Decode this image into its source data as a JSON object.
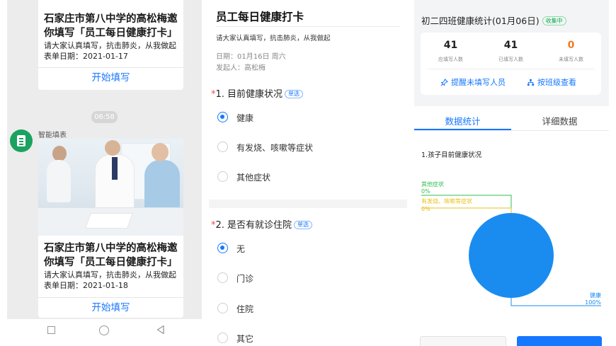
{
  "chat": {
    "card1": {
      "title": "石家庄市第八中学的高松梅邀你填写「员工每日健康打卡」",
      "desc": "请大家认真填写，抗击肺炎，从我做起",
      "date": "表单日期：2021-01-17",
      "button": "开始填写"
    },
    "time": "06:58",
    "sender": "智能填表",
    "card2": {
      "title": "石家庄市第八中学的高松梅邀你填写「员工每日健康打卡」",
      "desc": "请大家认真填写，抗击肺炎，从我做起",
      "date": "表单日期：2021-01-18",
      "button": "开始填写"
    }
  },
  "form": {
    "title": "员工每日健康打卡",
    "subtitle": "请大家认真填写，抗击肺炎，从我做起",
    "date": "日期：01月16日 周六",
    "creator": "发起人：高松梅",
    "q1": {
      "star": "*",
      "label": "1. 目前健康状况",
      "tag": "单选",
      "options": [
        "健康",
        "有发烧、咳嗽等症状",
        "其他症状"
      ],
      "selected": 0
    },
    "q2": {
      "star": "*",
      "label": "2. 是否有就诊住院",
      "tag": "单选",
      "options": [
        "无",
        "门诊",
        "住院",
        "其它"
      ],
      "selected": 0
    }
  },
  "stats": {
    "title": "初二四班健康统计(01月06日)",
    "status_tag": "收集中",
    "metrics": [
      {
        "value": "41",
        "label": "应填写人数"
      },
      {
        "value": "41",
        "label": "已填写人数"
      },
      {
        "value": "0",
        "label": "未填写人数"
      }
    ],
    "actions": {
      "remind": "提醒未填写人员",
      "by_class": "按班级查看"
    },
    "tabs": [
      "数据统计",
      "详细数据"
    ],
    "chart_question": "1.孩子目前健康状况",
    "colors": {
      "accent": "#1677ff",
      "series_blue": "#1a8cf0",
      "series_green": "#2fbf4f",
      "series_yellow": "#e7c21c",
      "warning": "#f07b22"
    }
  },
  "chart_data": {
    "type": "pie",
    "title": "1.孩子目前健康状况",
    "slices": [
      {
        "label": "健康",
        "value": 100,
        "display": "100%",
        "color": "#1a8cf0"
      },
      {
        "label": "其他症状",
        "value": 0,
        "display": "0%",
        "color": "#2fbf4f"
      },
      {
        "label": "有发烧、咳嗽等症状",
        "value": 0,
        "display": "0%",
        "color": "#e7c21c"
      }
    ]
  }
}
